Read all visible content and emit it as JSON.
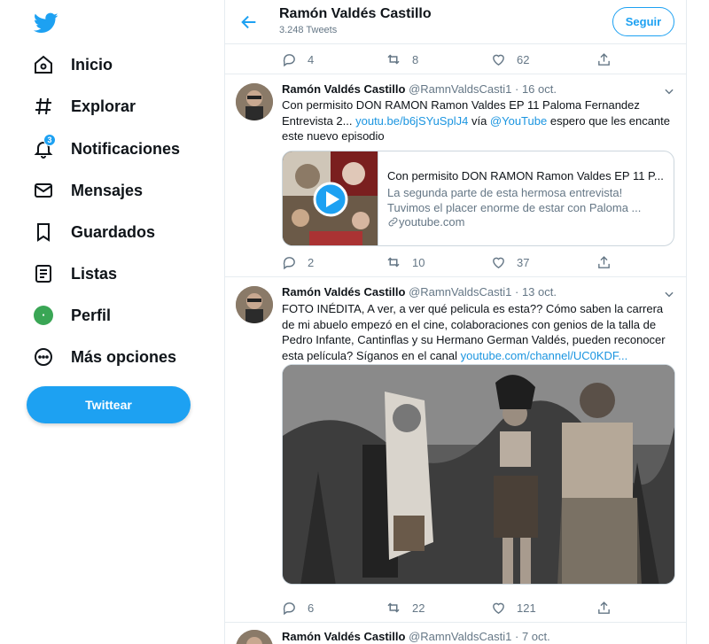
{
  "sidebar": {
    "logo_icon": "twitter-bird-icon",
    "items": [
      {
        "label": "Inicio",
        "icon": "home-icon"
      },
      {
        "label": "Explorar",
        "icon": "hashtag-icon"
      },
      {
        "label": "Notificaciones",
        "icon": "bell-icon",
        "badge": "3"
      },
      {
        "label": "Mensajes",
        "icon": "mail-icon"
      },
      {
        "label": "Guardados",
        "icon": "bookmark-icon"
      },
      {
        "label": "Listas",
        "icon": "list-icon"
      },
      {
        "label": "Perfil",
        "icon": "profile-avatar-icon"
      },
      {
        "label": "Más opciones",
        "icon": "more-circle-icon"
      }
    ],
    "tweet_button": "Twittear"
  },
  "header": {
    "name": "Ramón Valdés Castillo",
    "tweet_count": "3.248 Tweets",
    "follow_button": "Seguir"
  },
  "top_actions": {
    "replies": "4",
    "retweets": "8",
    "likes": "62"
  },
  "tweets": [
    {
      "name": "Ramón Valdés Castillo",
      "handle": "@RamnValdsCasti1",
      "date": "16 oct.",
      "text_before": "Con permisito DON RAMON Ramon Valdes EP 11 Paloma Fernandez Entrevista 2...",
      "link1": "youtu.be/b6jSYuSplJ4",
      "text_mid": "vía",
      "link2": "@YouTube",
      "text_after": "espero que les encante este nuevo episodio",
      "card": {
        "title": "Con permisito DON RAMON Ramon Valdes EP 11 P...",
        "description": "La segunda parte de esta hermosa entrevista! Tuvimos el placer enorme de estar con Paloma ...",
        "domain": "youtube.com"
      },
      "replies": "2",
      "retweets": "10",
      "likes": "37"
    },
    {
      "name": "Ramón Valdés Castillo",
      "handle": "@RamnValdsCasti1",
      "date": "13 oct.",
      "text": "FOTO INÉDITA, A ver, a ver qué pelicula es esta?? Cómo saben la carrera de mi abuelo empezó en el cine, colaboraciones con genios de la talla de Pedro Infante, Cantinflas y su Hermano German Valdés, pueden reconocer esta película? Síganos en el canal",
      "link": "youtube.com/channel/UC0KDF...",
      "replies": "6",
      "retweets": "22",
      "likes": "121"
    },
    {
      "name": "Ramón Valdés Castillo",
      "handle": "@RamnValdsCasti1",
      "date": "7 oct."
    }
  ],
  "colors": {
    "accent": "#1da1f2",
    "text": "#0f1419",
    "muted": "#657786",
    "border": "#e6ecf0"
  }
}
